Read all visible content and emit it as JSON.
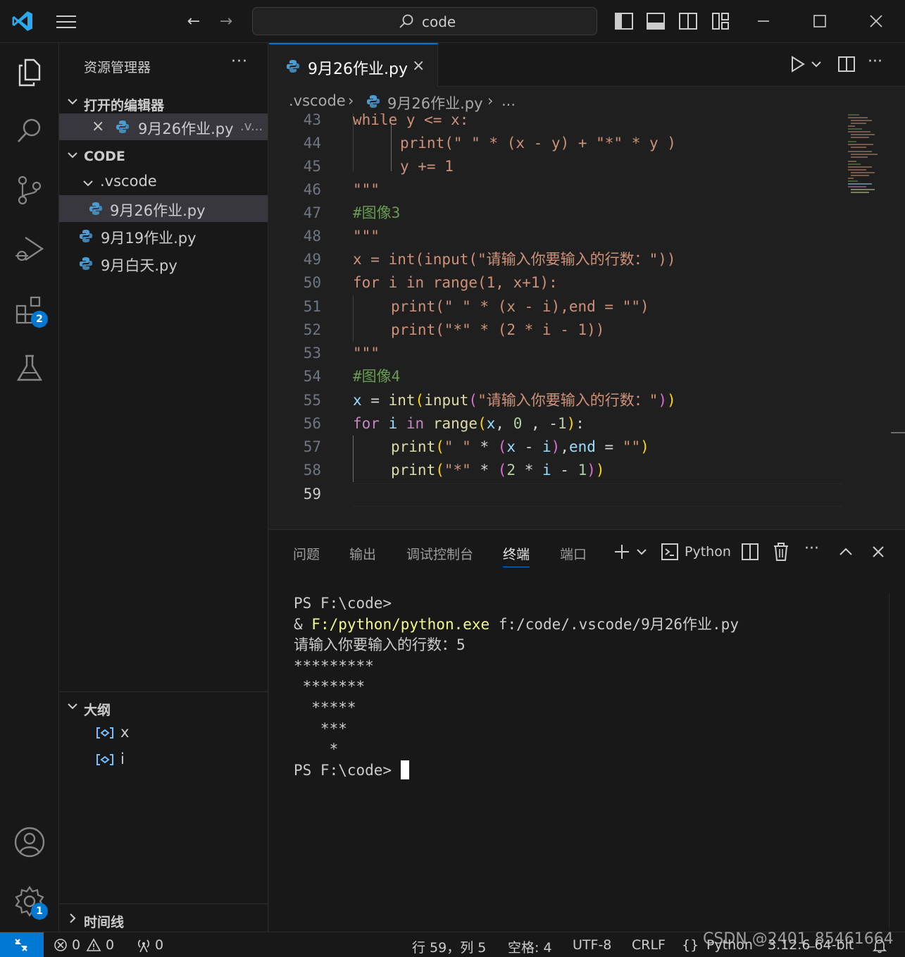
{
  "titlebar": {
    "search_text": "code",
    "back_glyph": "←",
    "forward_glyph": "→"
  },
  "activity": {
    "extensions_badge": "2",
    "settings_badge": "1"
  },
  "sidebar": {
    "title": "资源管理器",
    "more": "···",
    "open_editors_header": "打开的编辑器",
    "open_editors": [
      {
        "close": "×",
        "label": "9月26作业.py",
        "suffix": ".v..."
      }
    ],
    "folder_header": "CODE",
    "tree": [
      {
        "label": ".vscode"
      },
      {
        "label": "9月26作业.py"
      },
      {
        "label": "9月19作业.py"
      },
      {
        "label": "9月白天.py"
      }
    ],
    "outline_header": "大纲",
    "outline": [
      {
        "label": "x"
      },
      {
        "label": "i"
      }
    ],
    "timeline_header": "时间线"
  },
  "editor": {
    "tab_label": "9月26作业.py",
    "tab_close": "×",
    "breadcrumb": [
      ".vscode",
      "9月26作业.py",
      "..."
    ],
    "more": "···",
    "lines": [
      {
        "num": "43",
        "text": "while y <= x:"
      },
      {
        "num": "44",
        "text": "print(\" \" * (x - y) + \"*\" * y )"
      },
      {
        "num": "45",
        "text": "y += 1"
      },
      {
        "num": "46",
        "text": "\"\"\""
      },
      {
        "num": "47",
        "text": "#图像3"
      },
      {
        "num": "48",
        "text": "\"\"\""
      },
      {
        "num": "49",
        "text": "x = int(input(\"请输入你要输入的行数：\"))"
      },
      {
        "num": "50",
        "text": "for i in range(1, x+1):"
      },
      {
        "num": "51",
        "text": "print(\" \" * (x - i),end = \"\")"
      },
      {
        "num": "52",
        "text": "print(\"*\" * (2 * i - 1))"
      },
      {
        "num": "53",
        "text": "\"\"\""
      },
      {
        "num": "54",
        "text": "#图像4"
      },
      {
        "num": "55",
        "text": "x = int(input(\"请输入你要输入的行数：\"))"
      },
      {
        "num": "56",
        "text": "for i in range(x, 0 , -1):"
      },
      {
        "num": "57",
        "text": "print(\" \" * (x - i),end = \"\")"
      },
      {
        "num": "58",
        "text": "print(\"*\" * (2 * i - 1))"
      },
      {
        "num": "59",
        "text": ""
      }
    ]
  },
  "panel": {
    "tabs": [
      "问题",
      "输出",
      "调试控制台",
      "终端",
      "端口"
    ],
    "active_tab": "终端",
    "terminal_name": "Python",
    "more": "···",
    "terminal_lines": [
      "PS F:\\code>",
      "& F:/python/python.exe f:/code/.vscode/9月26作业.py",
      "请输入你要输入的行数：5",
      "*********",
      " *******",
      "  *****",
      "   ***",
      "    *",
      "PS F:\\code> "
    ]
  },
  "statusbar": {
    "errors": "0",
    "warnings": "0",
    "ports": "0",
    "position": "行 59，列 5",
    "spaces": "空格: 4",
    "encoding": "UTF-8",
    "eol": "CRLF",
    "language": "Python",
    "interpreter": "3.12.6 64-bit",
    "watermark": "CSDN @2401_85461664"
  }
}
